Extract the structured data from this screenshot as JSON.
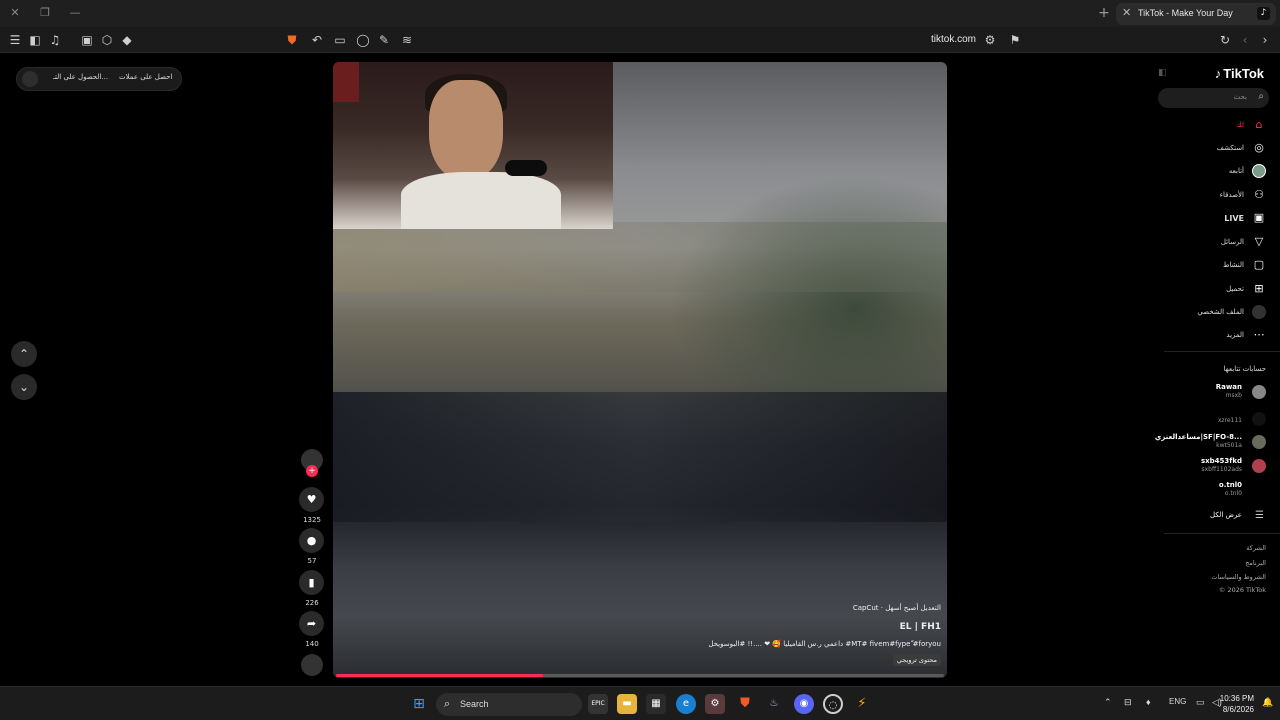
{
  "browser": {
    "tab_title": "TikTok - Make Your Day",
    "url": "tiktok.com"
  },
  "promo": {
    "item1": "الحصول على التـ...",
    "item2": "احصل على عملات"
  },
  "video": {
    "capcut_label": "CapCut · التعديل أصبح أسهل",
    "author": "EL | FH1",
    "description": "داعمي ر.س القاميليا 🥰 ❤ ....!! #البوسويحل #MT# fivem#fypeّ #foryou",
    "promo_tag": "محتوى ترويجي",
    "progress": 0.34
  },
  "actions": {
    "likes": "1325",
    "comments": "57",
    "saves": "226",
    "shares": "140"
  },
  "sidebar": {
    "logo": "TikTok",
    "search_placeholder": "بحث",
    "nav": [
      {
        "label": "لك",
        "icon": "home-icon"
      },
      {
        "label": "استكشف",
        "icon": "compass-icon"
      },
      {
        "label": "أتابعه",
        "icon": "avatar-icon"
      },
      {
        "label": "الأصدقاء",
        "icon": "friends-icon"
      },
      {
        "label": "LIVE",
        "icon": "live-icon"
      },
      {
        "label": "الرسائل",
        "icon": "send-icon"
      },
      {
        "label": "النشاط",
        "icon": "message-icon"
      },
      {
        "label": "تحميل",
        "icon": "upload-icon"
      },
      {
        "label": "الملف الشخصي",
        "icon": "profile-icon"
      },
      {
        "label": "المزيد",
        "icon": "more-icon"
      }
    ],
    "following_title": "حسابات تتابعها",
    "accounts": [
      {
        "name": "Rawan",
        "handle": "msxb"
      },
      {
        "name": "",
        "handle": "xzre111"
      },
      {
        "name": "مساعدالعنزي|SF|FO-8...",
        "handle": "kwt501a"
      },
      {
        "name": "sxb453fkd",
        "handle": "sxbff1102ads"
      },
      {
        "name": "o.tnl0",
        "handle": "o.tnl0"
      }
    ],
    "see_all": "عرض الكل",
    "footer": [
      "الشركة",
      "البرنامج",
      "الشروط والسياسات",
      "© 2026 TikTok"
    ]
  },
  "taskbar": {
    "search_label": "Search",
    "lang": "ENG",
    "time": "10:36 PM",
    "date": "8/6/2026"
  }
}
